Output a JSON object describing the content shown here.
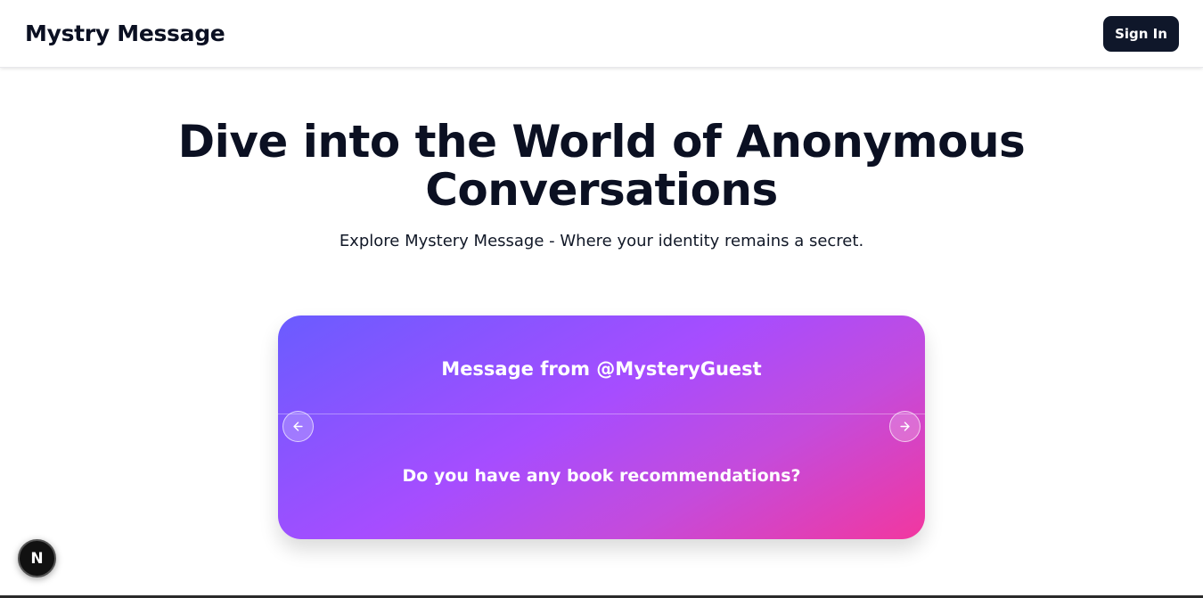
{
  "navbar": {
    "brand": "Mystry Message",
    "signin_label": "Sign In"
  },
  "hero": {
    "title": "Dive into the World of Anonymous Conversations",
    "subtitle": "Explore Mystery Message - Where your identity remains a secret."
  },
  "carousel": {
    "header": "Message from @MysteryGuest",
    "message": "Do you have any book recommendations?",
    "prev_icon": "arrow-left-icon",
    "next_icon": "arrow-right-icon"
  },
  "dev_badge": {
    "letter": "N",
    "icon": "nextjs-logo-icon"
  },
  "colors": {
    "primary_button": "#0f172a",
    "card_gradient_start": "#6a5cff",
    "card_gradient_mid": "#a64dff",
    "card_gradient_end": "#f2379f",
    "text": "#0b1022"
  }
}
